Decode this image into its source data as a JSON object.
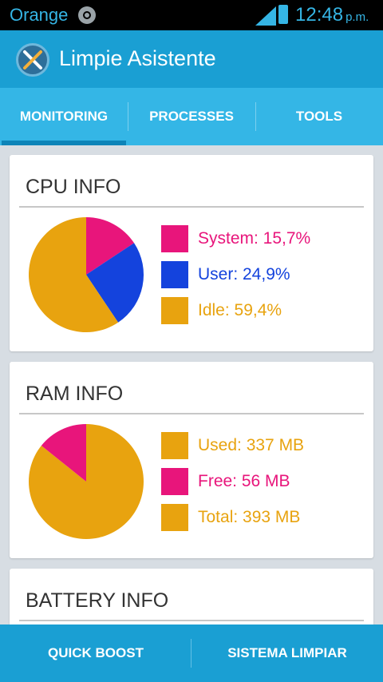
{
  "status_bar": {
    "carrier": "Orange",
    "time": "12:48",
    "ampm": "p.m.",
    "signal_color": "#35b5e5"
  },
  "app": {
    "title": "Limpie Asistente"
  },
  "tabs": [
    {
      "label": "MONITORING",
      "active": true
    },
    {
      "label": "PROCESSES"
    },
    {
      "label": "TOOLS"
    }
  ],
  "cpu": {
    "title": "CPU INFO",
    "legend": [
      {
        "text": "System: 15,7%",
        "color": "#e8157b"
      },
      {
        "text": "User: 24,9%",
        "color": "#1443dd"
      },
      {
        "text": "Idle: 59,4%",
        "color": "#e8a30f"
      }
    ]
  },
  "ram": {
    "title": "RAM INFO",
    "legend": [
      {
        "text": "Used: 337 MB",
        "color": "#e8a30f"
      },
      {
        "text": "Free: 56 MB",
        "color": "#e8157b"
      },
      {
        "text": "Total: 393 MB",
        "color": "#e8a30f"
      }
    ]
  },
  "battery": {
    "title": "BATTERY INFO"
  },
  "bottom_bar": {
    "quick_boost": "QUICK BOOST",
    "sistema_limpiar": "SISTEMA LIMPIAR"
  },
  "chart_data": [
    {
      "type": "pie",
      "title": "CPU INFO",
      "categories": [
        "System",
        "User",
        "Idle"
      ],
      "values": [
        15.7,
        24.9,
        59.4
      ],
      "colors": [
        "#e8157b",
        "#1443dd",
        "#e8a30f"
      ]
    },
    {
      "type": "pie",
      "title": "RAM INFO",
      "categories": [
        "Used",
        "Free"
      ],
      "values": [
        337,
        56
      ],
      "colors": [
        "#e8a30f",
        "#e8157b"
      ]
    }
  ]
}
